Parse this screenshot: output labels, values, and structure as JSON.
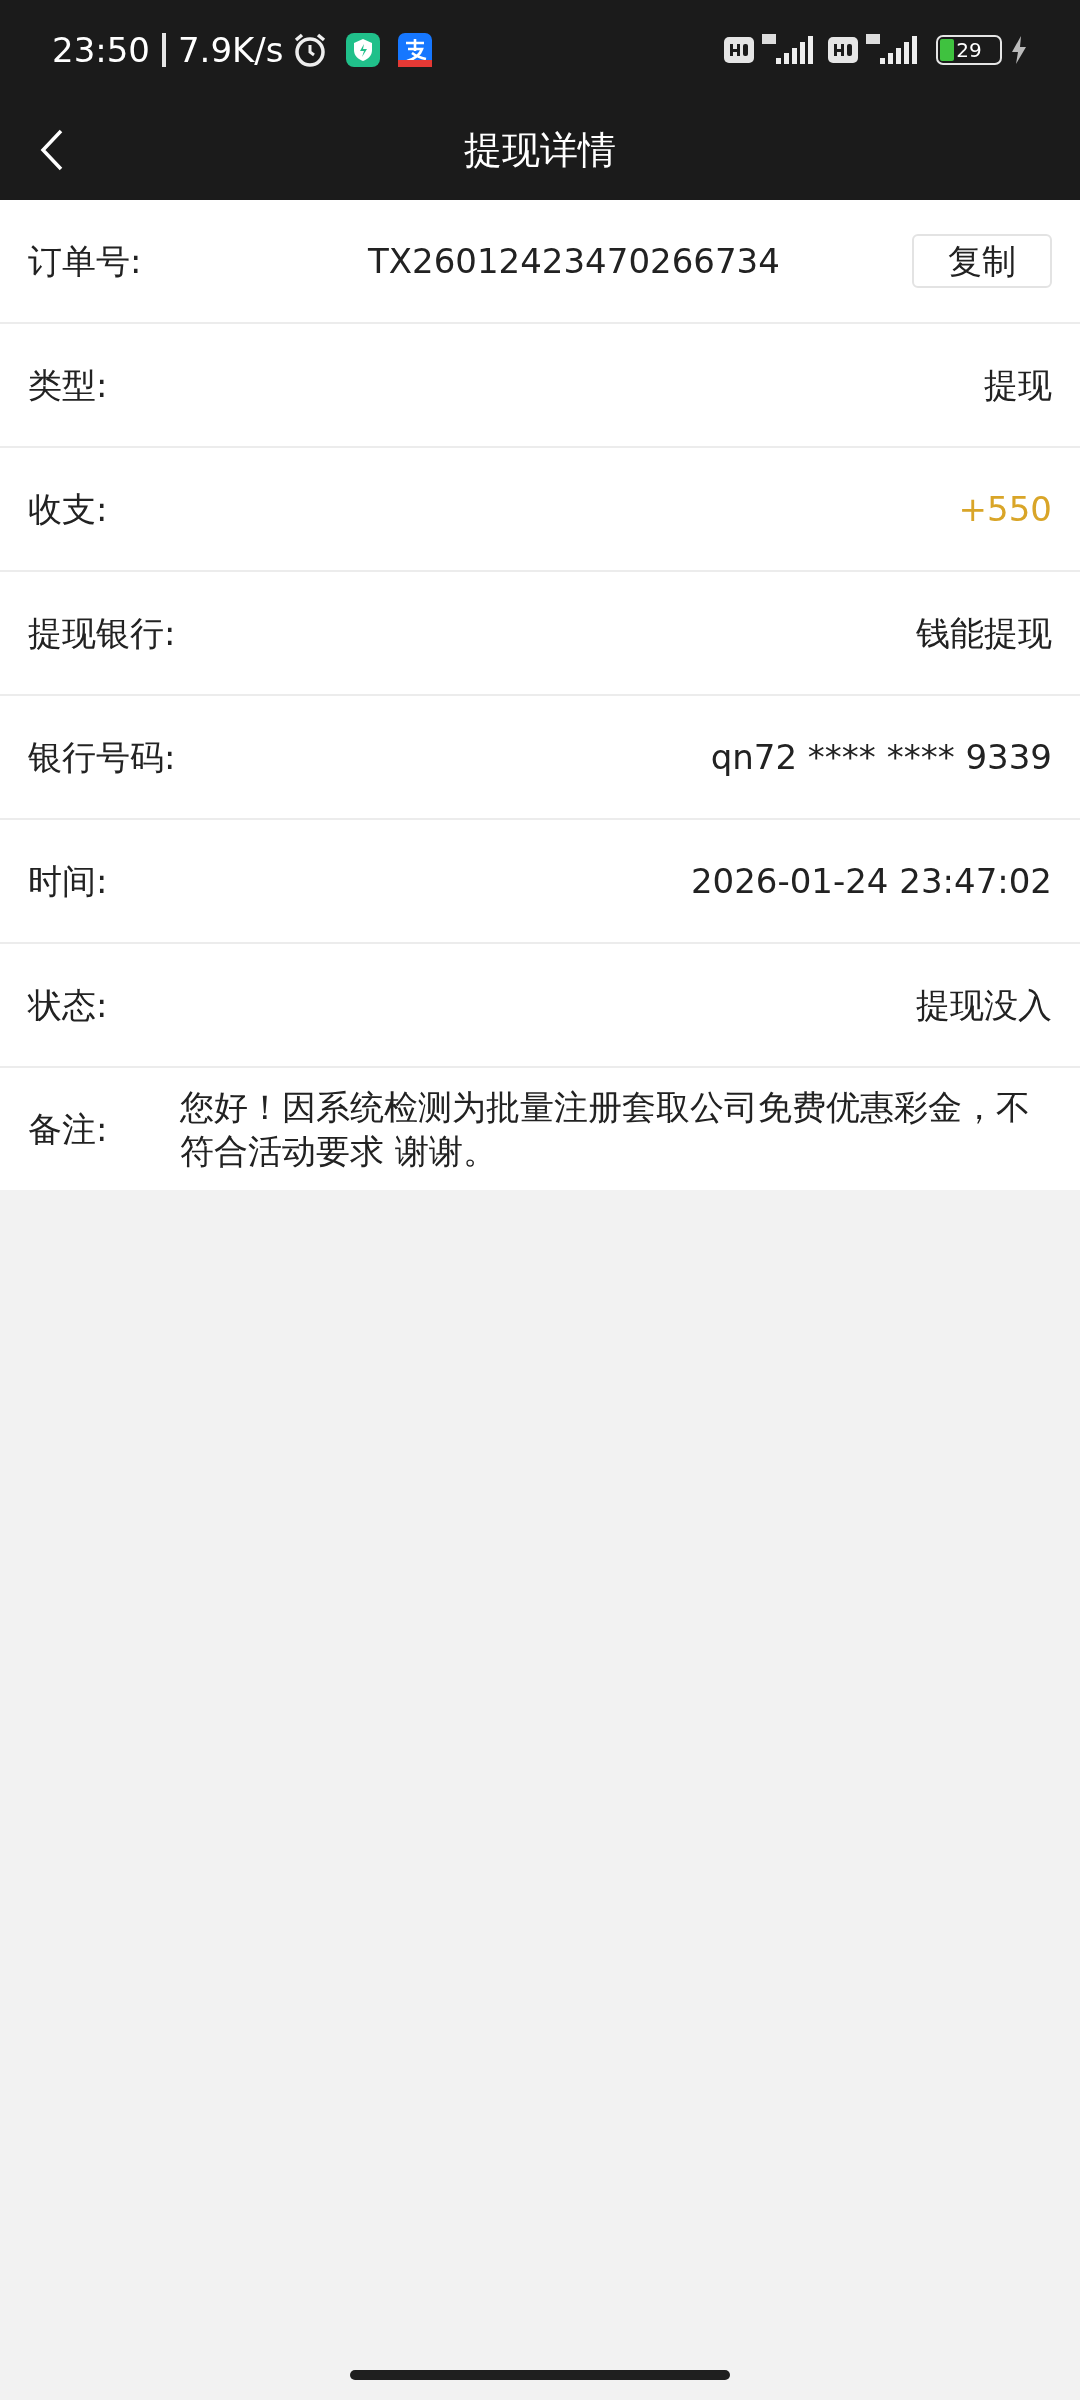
{
  "status_bar": {
    "time": "23:50",
    "speed": "7.9K/s",
    "battery": "29"
  },
  "header": {
    "title": "提现详情"
  },
  "rows": [
    {
      "kind": "order",
      "label": "订单号:",
      "value": "TX26012423470266734",
      "button": "复制"
    },
    {
      "kind": "text",
      "label": "类型:",
      "value": "提现"
    },
    {
      "kind": "amount",
      "label": "收支:",
      "value": "+550"
    },
    {
      "kind": "text",
      "label": "提现银行:",
      "value": "钱能提现"
    },
    {
      "kind": "text",
      "label": "银行号码:",
      "value": "qn72 **** **** 9339"
    },
    {
      "kind": "text",
      "label": "时间:",
      "value": "2026-01-24 23:47:02"
    },
    {
      "kind": "text",
      "label": "状态:",
      "value": "提现没入"
    },
    {
      "kind": "note",
      "label": "备注:",
      "value": "您好！因系统检测为批量注册套取公司免费优惠彩金，不符合活动要求 谢谢。"
    }
  ]
}
